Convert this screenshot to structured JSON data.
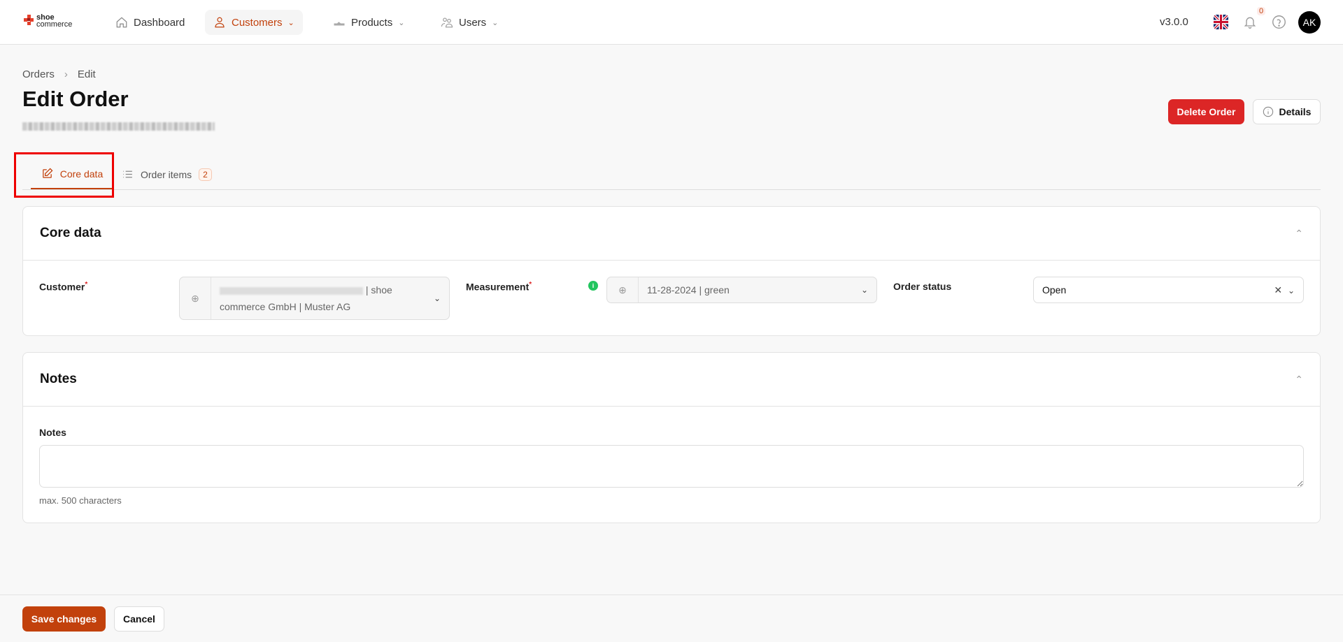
{
  "header": {
    "logo_top": "shoe",
    "logo_bottom": "commerce",
    "nav": [
      {
        "label": "Dashboard",
        "icon": "home-icon"
      },
      {
        "label": "Customers",
        "icon": "user-icon",
        "active": true
      },
      {
        "label": "Products",
        "icon": "shoe-icon"
      },
      {
        "label": "Users",
        "icon": "users-icon"
      }
    ],
    "version": "v3.0.0",
    "notification_count": "0",
    "avatar_initials": "AK"
  },
  "breadcrumb": [
    "Orders",
    "Edit"
  ],
  "page": {
    "title": "Edit Order",
    "delete_label": "Delete Order",
    "details_label": "Details"
  },
  "tabs": [
    {
      "label": "Core data",
      "active": true
    },
    {
      "label": "Order items",
      "count": "2"
    }
  ],
  "core": {
    "title": "Core data",
    "customer_label": "Customer",
    "customer_value": "| shoe commerce GmbH | Muster AG",
    "measurement_label": "Measurement",
    "measurement_value": "11-28-2024 | green",
    "status_label": "Order status",
    "status_value": "Open"
  },
  "notes": {
    "title": "Notes",
    "label": "Notes",
    "value": "",
    "hint": "max. 500 characters"
  },
  "footer": {
    "save_label": "Save changes",
    "cancel_label": "Cancel"
  },
  "colors": {
    "accent": "#c2410c",
    "danger": "#dc2626",
    "success": "#22c55e"
  }
}
